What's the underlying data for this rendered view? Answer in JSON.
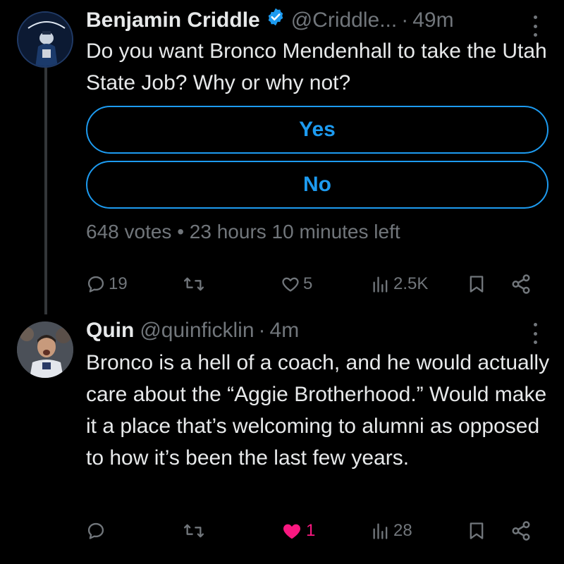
{
  "tweet": {
    "display_name": "Benjamin Criddle",
    "handle": "@Criddle...",
    "time": "49m",
    "text": "Do you want Bronco Mendenhall to take the Utah State Job? Why or why not?",
    "poll": {
      "options": [
        "Yes",
        "No"
      ],
      "votes": "648 votes",
      "time_left": "23 hours 10 minutes left"
    },
    "stats": {
      "replies": "19",
      "retweets": "",
      "likes": "5",
      "views": "2.5K"
    }
  },
  "reply": {
    "display_name": "Quin",
    "handle": "@quinficklin",
    "time": "4m",
    "text": "Bronco is a hell of a coach, and he would actually care about the “Aggie Brotherhood.” Would make it a place that’s welcoming to alumni as opposed to how it’s been the last few years.",
    "stats": {
      "replies": "",
      "retweets": "",
      "likes": "1",
      "views": "28"
    }
  },
  "colors": {
    "accent": "#1d9bf0",
    "muted": "#71767b",
    "like": "#f91880",
    "text": "#e7e9ea",
    "background": "#000000"
  }
}
